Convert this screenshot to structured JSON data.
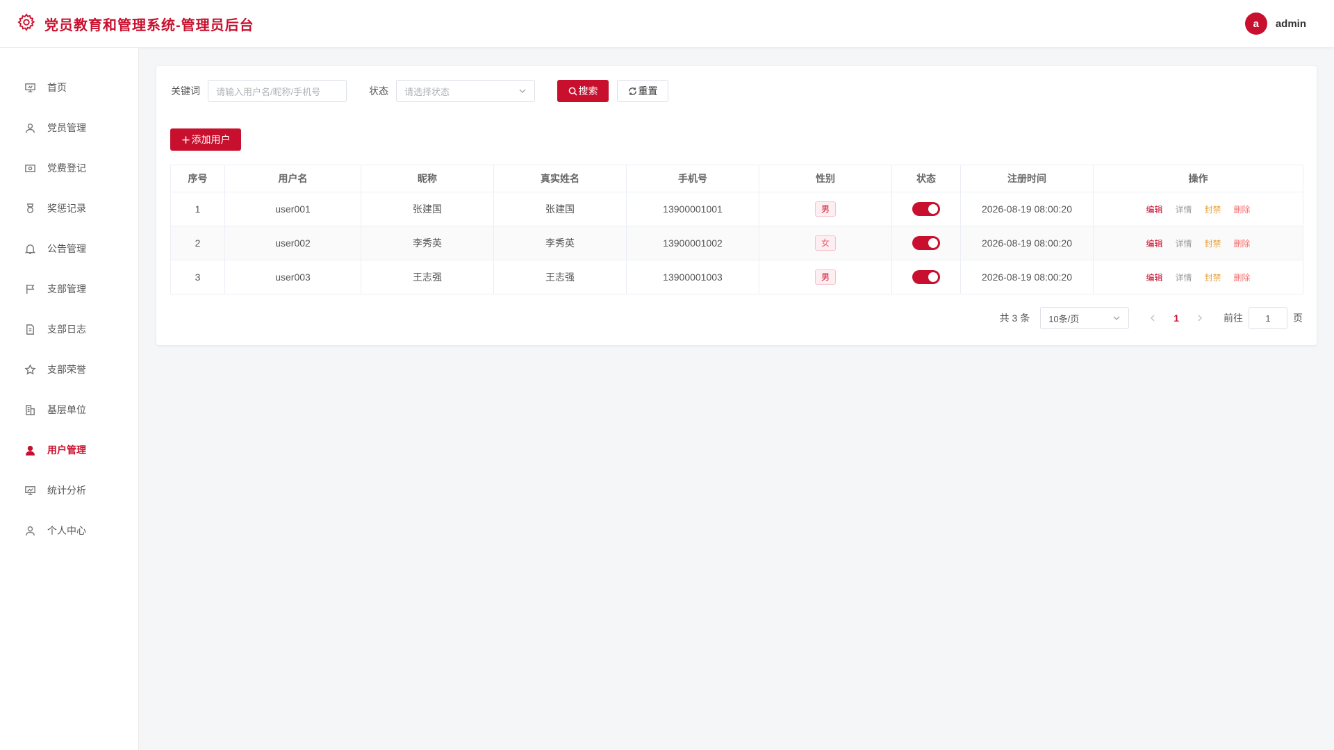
{
  "app": {
    "title": "党员教育和管理系统-管理员后台"
  },
  "user": {
    "avatar_letter": "a",
    "name": "admin"
  },
  "colors": {
    "brand": "#c8102e"
  },
  "sidebar": {
    "items": [
      {
        "label": "首页",
        "icon": "presentation-icon",
        "active": false
      },
      {
        "label": "党员管理",
        "icon": "user-icon",
        "active": false
      },
      {
        "label": "党费登记",
        "icon": "wallet-icon",
        "active": false
      },
      {
        "label": "奖惩记录",
        "icon": "medal-icon",
        "active": false
      },
      {
        "label": "公告管理",
        "icon": "bell-icon",
        "active": false
      },
      {
        "label": "支部管理",
        "icon": "flag-icon",
        "active": false
      },
      {
        "label": "支部日志",
        "icon": "document-icon",
        "active": false
      },
      {
        "label": "支部荣誉",
        "icon": "star-icon",
        "active": false
      },
      {
        "label": "基层单位",
        "icon": "building-icon",
        "active": false
      },
      {
        "label": "用户管理",
        "icon": "user-filled-icon",
        "active": true
      },
      {
        "label": "统计分析",
        "icon": "chart-board-icon",
        "active": false
      },
      {
        "label": "个人中心",
        "icon": "user-icon",
        "active": false
      }
    ]
  },
  "filter": {
    "keyword_label": "关键词",
    "keyword_placeholder": "请输入用户名/昵称/手机号",
    "status_label": "状态",
    "status_placeholder": "请选择状态",
    "search_label": "搜索",
    "reset_label": "重置"
  },
  "toolbar": {
    "add_label": "添加用户"
  },
  "table": {
    "columns": [
      "序号",
      "用户名",
      "昵称",
      "真实姓名",
      "手机号",
      "性别",
      "状态",
      "注册时间",
      "操作"
    ],
    "rows": [
      {
        "index": "1",
        "username": "user001",
        "nickname": "张建国",
        "realname": "张建国",
        "phone": "13900001001",
        "gender": "男",
        "enabled": true,
        "registered": "2026-08-19 08:00:20"
      },
      {
        "index": "2",
        "username": "user002",
        "nickname": "李秀英",
        "realname": "李秀英",
        "phone": "13900001002",
        "gender": "女",
        "enabled": true,
        "registered": "2026-08-19 08:00:20"
      },
      {
        "index": "3",
        "username": "user003",
        "nickname": "王志强",
        "realname": "王志强",
        "phone": "13900001003",
        "gender": "男",
        "enabled": true,
        "registered": "2026-08-19 08:00:20"
      }
    ],
    "actions": {
      "edit": "编辑",
      "detail": "详情",
      "ban": "封禁",
      "delete": "删除"
    }
  },
  "pagination": {
    "total_text": "共 3 条",
    "page_size": "10条/页",
    "current_page": "1",
    "goto_label": "前往",
    "goto_value": "1",
    "page_suffix": "页"
  }
}
